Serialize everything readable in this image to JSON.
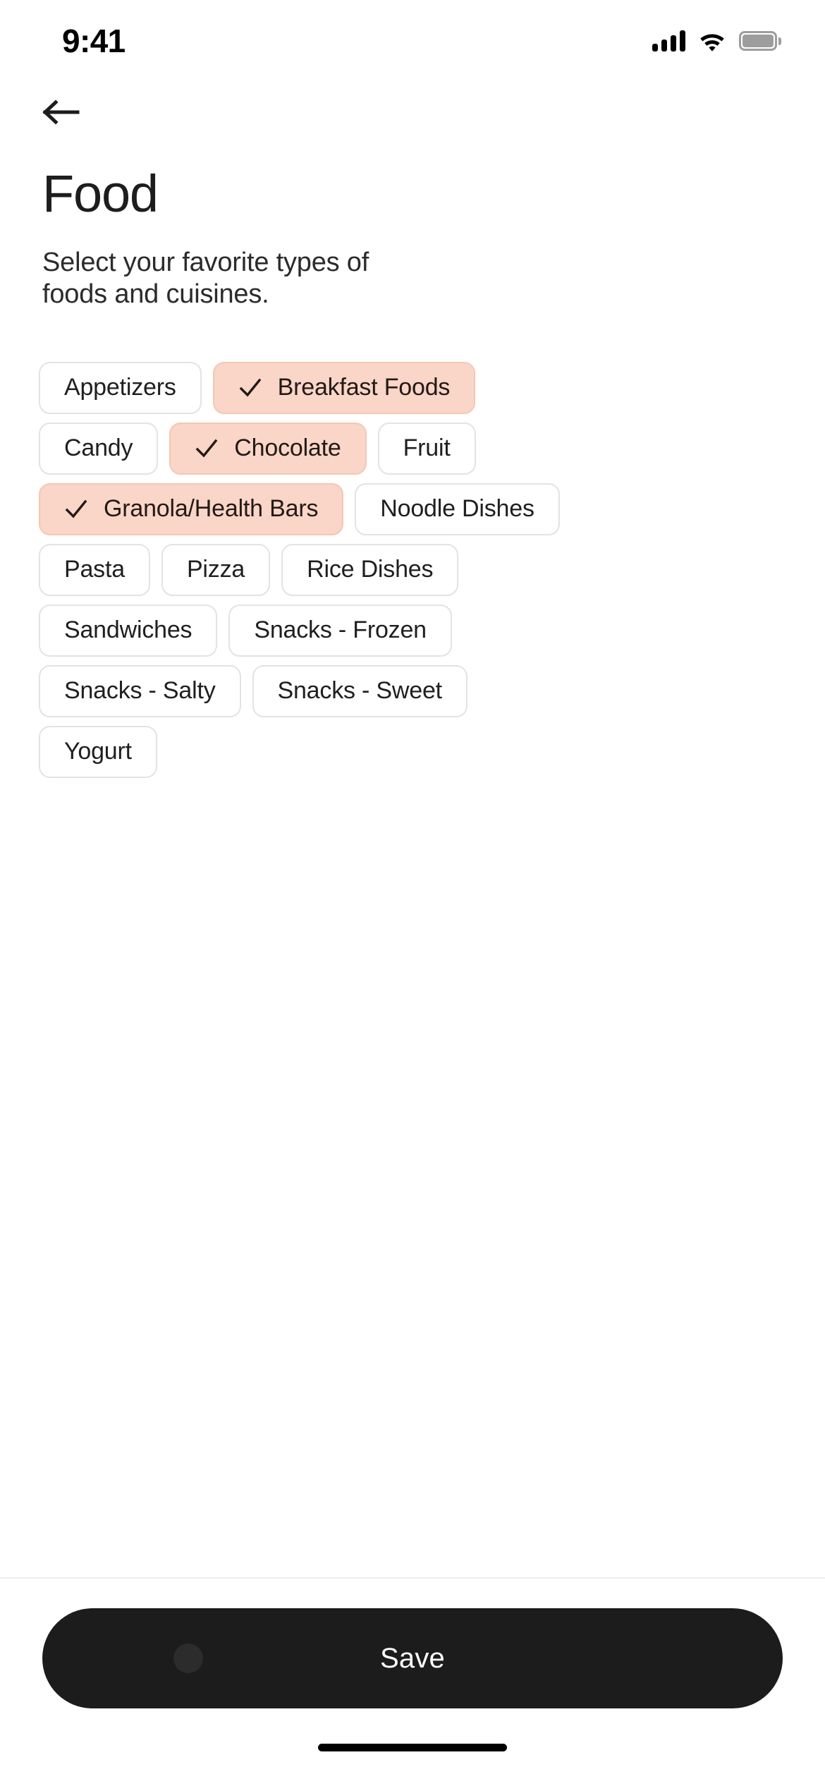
{
  "status_bar": {
    "time": "9:41",
    "cellular_icon": "cellular-signal-icon",
    "wifi_icon": "wifi-icon",
    "battery_icon": "battery-full-icon"
  },
  "nav": {
    "back_icon": "back-arrow-icon"
  },
  "header": {
    "title": "Food",
    "subtitle": "Select your favorite types of foods and cuisines."
  },
  "chips": {
    "check_icon": "check-icon",
    "rows": [
      [
        {
          "label": "Appetizers",
          "selected": false
        },
        {
          "label": "Breakfast Foods",
          "selected": true
        }
      ],
      [
        {
          "label": "Candy",
          "selected": false
        },
        {
          "label": "Chocolate",
          "selected": true
        },
        {
          "label": "Fruit",
          "selected": false
        }
      ],
      [
        {
          "label": "Granola/Health Bars",
          "selected": true
        },
        {
          "label": "Noodle Dishes",
          "selected": false
        }
      ],
      [
        {
          "label": "Pasta",
          "selected": false
        },
        {
          "label": "Pizza",
          "selected": false
        },
        {
          "label": "Rice Dishes",
          "selected": false
        }
      ],
      [
        {
          "label": "Sandwiches",
          "selected": false
        },
        {
          "label": "Snacks - Frozen",
          "selected": false
        }
      ],
      [
        {
          "label": "Snacks - Salty",
          "selected": false
        },
        {
          "label": "Snacks - Sweet",
          "selected": false
        }
      ],
      [
        {
          "label": "Yogurt",
          "selected": false
        }
      ]
    ]
  },
  "footer": {
    "save_label": "Save"
  },
  "colors": {
    "chip_selected_bg": "#f9d6c7",
    "chip_selected_border": "#f5c7b4",
    "chip_border": "#e3e3e3",
    "save_bg": "#1c1c1c",
    "text_primary": "#1d1d1d"
  }
}
